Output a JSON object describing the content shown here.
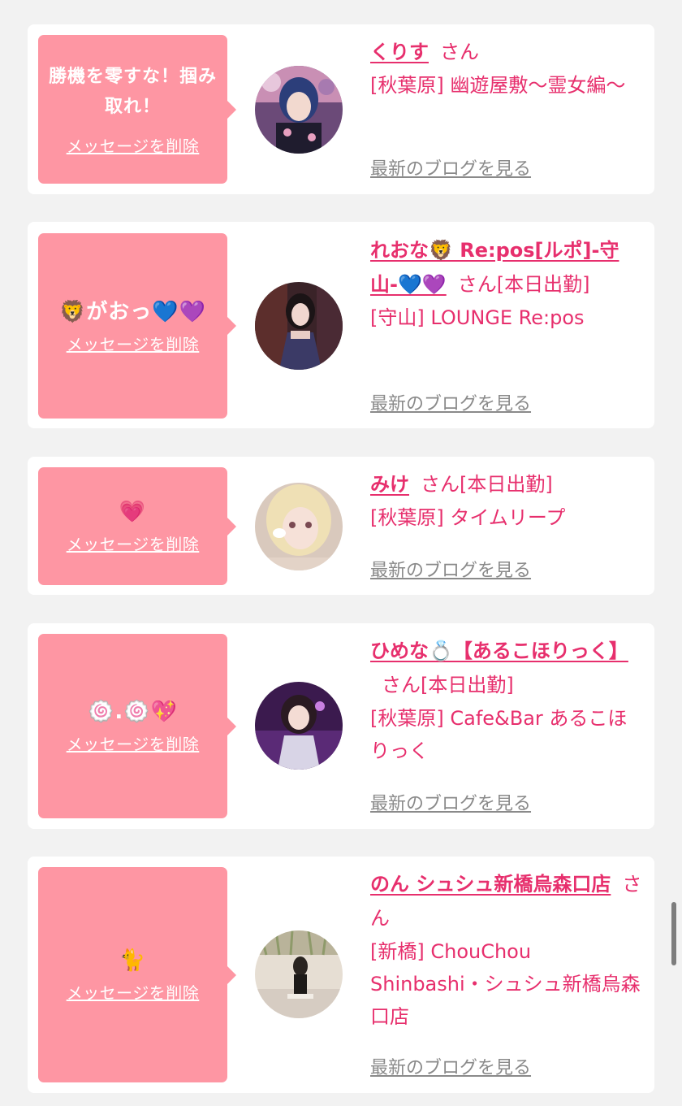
{
  "common": {
    "delete_label": "メッセージを削除",
    "san_label": "さん",
    "blog_label": "最新のブログを見る"
  },
  "colors": {
    "bubble": "#fe96a3",
    "accent": "#e72f6d",
    "page_bg": "#f2f2f2",
    "card_bg": "#ffffff",
    "muted_link": "#8a8a8a"
  },
  "cards": [
    {
      "message": "勝機を零すな！掴み取れ！",
      "name": "くりす",
      "status": "",
      "shop": "[秋葉原] 幽遊屋敷〜霊女編〜"
    },
    {
      "message": "🦁がおっ💙💜",
      "name": "れおな🦁 Re:pos[ルポ]-守山-💙💜",
      "status": "[本日出勤]",
      "shop": "[守山] LOUNGE Re:pos"
    },
    {
      "message": "💗",
      "name": "みけ",
      "status": "[本日出勤]",
      "shop": "[秋葉原] タイムリープ"
    },
    {
      "message": "🍥.🍥💖",
      "name": "ひめな💍【あるこほりっく】",
      "status": "[本日出勤]",
      "shop": "[秋葉原] Cafe&Bar あるこほりっく"
    },
    {
      "message": "🐈",
      "name": "のん シュシュ新橋烏森口店",
      "status": "",
      "shop": "[新橋] ChouChou Shinbashi・シュシュ新橋烏森口店"
    }
  ]
}
